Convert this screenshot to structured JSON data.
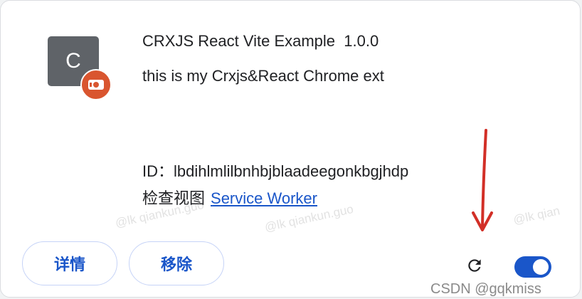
{
  "extension": {
    "icon_letter": "C",
    "title": "CRXJS React Vite Example  1.0.0",
    "description": "this is my Crxjs&React Chrome ext",
    "id_label": "ID：",
    "id_value": "lbdihlmlilbnhbjblaadeegonkbgjhdp",
    "views_label": "检查视图",
    "service_worker_link": "Service Worker"
  },
  "actions": {
    "details_label": "详情",
    "remove_label": "移除",
    "reload_icon": "reload-icon",
    "enabled": true
  },
  "watermarks": [
    "@lk qiankun.guo",
    "@lk qiankun.guo",
    "@lk qian"
  ],
  "source_credit": "CSDN @gqkmiss",
  "colors": {
    "accent": "#1a56c9",
    "badge": "#d9552f",
    "icon_bg": "#5f6368",
    "arrow": "#d22f27"
  }
}
